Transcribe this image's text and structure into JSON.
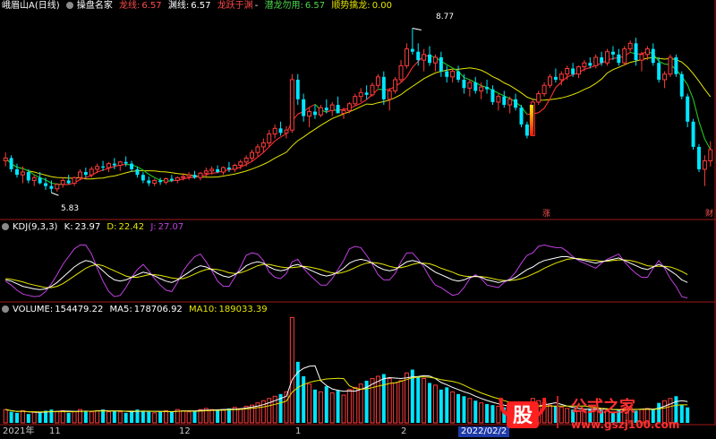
{
  "header": {
    "stock_name": "峨眉山A",
    "period": "(日线)",
    "indicator_name": "操盘名家",
    "items": [
      {
        "label": "龙线:",
        "value": "6.57",
        "color": "#ff4a4a"
      },
      {
        "label": "渊线:",
        "value": "6.57",
        "color": "#ffffff"
      },
      {
        "label": "龙跃于渊",
        "value": "",
        "color": "#ff4a4a"
      },
      {
        "label": "-",
        "value": "",
        "color": "#ffffff"
      },
      {
        "label": "潜龙勿用:",
        "value": "6.57",
        "color": "#4cd94c"
      },
      {
        "label": "顺势擒龙:",
        "value": "0.00",
        "color": "#e6e600"
      }
    ]
  },
  "kdj_header": {
    "name": "KDJ(9,3,3)",
    "k_label": "K:",
    "k_value": "23.97",
    "d_label": "D:",
    "d_value": "22.42",
    "j_label": "J:",
    "j_value": "27.07"
  },
  "volume_header": {
    "name": "VOLUME:",
    "value": "154479.22",
    "ma5_label": "MA5:",
    "ma5_value": "178706.92",
    "ma10_label": "MA10:",
    "ma10_value": "189033.39"
  },
  "markers": {
    "high_label": "8.77",
    "low_label": "5.83",
    "zhang": "涨",
    "cai": "财"
  },
  "x_axis": {
    "labels": [
      "2021年",
      "11",
      "12",
      "1",
      "2"
    ],
    "current_date": "2022/02/2"
  },
  "watermark": {
    "badge": "股",
    "title": "公式之家",
    "url": "www.gszj100.com"
  },
  "colors": {
    "up": "#ff3c3c",
    "down": "#00e6ff",
    "red_line": "#ff3030",
    "yellow_line": "#e6e600",
    "green_line": "#20c820",
    "purple_line": "#c040e0",
    "kdj_white": "#ffffff",
    "kdj_yellow": "#e6e600",
    "divider": "#a01818"
  },
  "chart_data": {
    "type": "candlestick",
    "price_range": [
      5.4,
      9.05
    ],
    "high": 8.77,
    "low": 5.83,
    "ohlc": [
      [
        6.4,
        6.55,
        6.3,
        6.45
      ],
      [
        6.45,
        6.5,
        6.2,
        6.25
      ],
      [
        6.25,
        6.35,
        6.1,
        6.15
      ],
      [
        6.15,
        6.3,
        6.0,
        6.2
      ],
      [
        6.2,
        6.25,
        6.0,
        6.05
      ],
      [
        6.05,
        6.15,
        5.95,
        6.1
      ],
      [
        6.1,
        6.2,
        5.98,
        6.0
      ],
      [
        6.0,
        6.1,
        5.88,
        5.95
      ],
      [
        5.95,
        6.05,
        5.83,
        5.9
      ],
      [
        5.9,
        6.0,
        5.85,
        5.98
      ],
      [
        5.98,
        6.1,
        5.92,
        6.05
      ],
      [
        6.05,
        6.15,
        5.98,
        6.0
      ],
      [
        6.0,
        6.12,
        5.95,
        6.1
      ],
      [
        6.1,
        6.25,
        6.05,
        6.2
      ],
      [
        6.2,
        6.28,
        6.1,
        6.15
      ],
      [
        6.15,
        6.3,
        6.1,
        6.25
      ],
      [
        6.25,
        6.35,
        6.18,
        6.3
      ],
      [
        6.3,
        6.4,
        6.22,
        6.28
      ],
      [
        6.28,
        6.38,
        6.2,
        6.35
      ],
      [
        6.35,
        6.45,
        6.25,
        6.32
      ],
      [
        6.32,
        6.4,
        6.22,
        6.38
      ],
      [
        6.38,
        6.48,
        6.3,
        6.35
      ],
      [
        6.35,
        6.4,
        6.2,
        6.25
      ],
      [
        6.25,
        6.3,
        6.1,
        6.15
      ],
      [
        6.15,
        6.2,
        6.0,
        6.05
      ],
      [
        6.05,
        6.12,
        5.95,
        6.0
      ],
      [
        6.0,
        6.08,
        5.95,
        6.05
      ],
      [
        6.05,
        6.1,
        5.97,
        6.02
      ],
      [
        6.02,
        6.1,
        5.98,
        6.08
      ],
      [
        6.08,
        6.15,
        6.02,
        6.05
      ],
      [
        6.05,
        6.12,
        6.0,
        6.1
      ],
      [
        6.1,
        6.18,
        6.05,
        6.12
      ],
      [
        6.12,
        6.2,
        6.06,
        6.15
      ],
      [
        6.15,
        6.22,
        6.08,
        6.1
      ],
      [
        6.1,
        6.2,
        6.05,
        6.18
      ],
      [
        6.18,
        6.28,
        6.12,
        6.22
      ],
      [
        6.22,
        6.3,
        6.15,
        6.25
      ],
      [
        6.25,
        6.32,
        6.18,
        6.2
      ],
      [
        6.2,
        6.3,
        6.15,
        6.28
      ],
      [
        6.28,
        6.38,
        6.2,
        6.25
      ],
      [
        6.25,
        6.35,
        6.2,
        6.32
      ],
      [
        6.32,
        6.42,
        6.25,
        6.38
      ],
      [
        6.38,
        6.5,
        6.3,
        6.45
      ],
      [
        6.45,
        6.6,
        6.4,
        6.55
      ],
      [
        6.55,
        6.7,
        6.48,
        6.65
      ],
      [
        6.65,
        6.8,
        6.55,
        6.72
      ],
      [
        6.72,
        6.95,
        6.65,
        6.88
      ],
      [
        6.88,
        7.05,
        6.8,
        6.98
      ],
      [
        6.98,
        7.1,
        6.85,
        6.9
      ],
      [
        6.9,
        7.02,
        6.8,
        6.95
      ],
      [
        6.95,
        7.95,
        6.9,
        7.85
      ],
      [
        7.85,
        7.95,
        7.4,
        7.5
      ],
      [
        7.5,
        7.6,
        7.1,
        7.2
      ],
      [
        7.2,
        7.35,
        7.0,
        7.28
      ],
      [
        7.28,
        7.4,
        7.15,
        7.22
      ],
      [
        7.22,
        7.4,
        7.18,
        7.35
      ],
      [
        7.35,
        7.5,
        7.25,
        7.3
      ],
      [
        7.3,
        7.45,
        7.2,
        7.4
      ],
      [
        7.4,
        7.55,
        7.3,
        7.25
      ],
      [
        7.25,
        7.35,
        7.15,
        7.3
      ],
      [
        7.3,
        7.45,
        7.25,
        7.42
      ],
      [
        7.42,
        7.6,
        7.38,
        7.55
      ],
      [
        7.55,
        7.7,
        7.45,
        7.62
      ],
      [
        7.62,
        7.75,
        7.5,
        7.58
      ],
      [
        7.58,
        7.8,
        7.55,
        7.75
      ],
      [
        7.75,
        7.95,
        7.7,
        7.9
      ],
      [
        7.9,
        8.0,
        7.4,
        7.5
      ],
      [
        7.5,
        7.7,
        7.3,
        7.65
      ],
      [
        7.65,
        7.9,
        7.6,
        7.85
      ],
      [
        7.85,
        8.2,
        7.8,
        8.1
      ],
      [
        8.1,
        8.5,
        8.05,
        8.4
      ],
      [
        8.4,
        8.77,
        8.3,
        8.35
      ],
      [
        8.35,
        8.5,
        8.1,
        8.2
      ],
      [
        8.2,
        8.4,
        8.0,
        8.3
      ],
      [
        8.3,
        8.45,
        8.1,
        8.15
      ],
      [
        8.15,
        8.3,
        8.0,
        8.25
      ],
      [
        8.25,
        8.35,
        7.9,
        8.0
      ],
      [
        8.0,
        8.1,
        7.8,
        7.9
      ],
      [
        7.9,
        8.05,
        7.8,
        8.0
      ],
      [
        8.0,
        8.1,
        7.8,
        7.85
      ],
      [
        7.85,
        7.95,
        7.6,
        7.7
      ],
      [
        7.7,
        7.85,
        7.55,
        7.8
      ],
      [
        7.8,
        7.9,
        7.6,
        7.65
      ],
      [
        7.65,
        7.8,
        7.5,
        7.72
      ],
      [
        7.72,
        7.85,
        7.6,
        7.68
      ],
      [
        7.68,
        7.75,
        7.4,
        7.45
      ],
      [
        7.45,
        7.6,
        7.3,
        7.55
      ],
      [
        7.55,
        7.65,
        7.35,
        7.4
      ],
      [
        7.4,
        7.55,
        7.25,
        7.5
      ],
      [
        7.5,
        7.6,
        7.3,
        7.35
      ],
      [
        7.35,
        7.4,
        7.0,
        7.05
      ],
      [
        7.05,
        7.1,
        6.8,
        6.85
      ],
      [
        6.85,
        7.5,
        6.85,
        7.45
      ],
      [
        7.45,
        7.65,
        7.4,
        7.6
      ],
      [
        7.6,
        7.8,
        7.55,
        7.75
      ],
      [
        7.75,
        7.95,
        7.7,
        7.9
      ],
      [
        7.9,
        8.05,
        7.8,
        7.85
      ],
      [
        7.85,
        8.0,
        7.75,
        7.95
      ],
      [
        7.95,
        8.1,
        7.85,
        8.05
      ],
      [
        8.05,
        8.15,
        7.9,
        7.95
      ],
      [
        7.95,
        8.1,
        7.88,
        8.08
      ],
      [
        8.08,
        8.2,
        8.0,
        8.15
      ],
      [
        8.15,
        8.25,
        8.05,
        8.1
      ],
      [
        8.1,
        8.3,
        8.05,
        8.25
      ],
      [
        8.25,
        8.35,
        8.1,
        8.15
      ],
      [
        8.15,
        8.4,
        8.1,
        8.35
      ],
      [
        8.35,
        8.45,
        8.2,
        8.3
      ],
      [
        8.3,
        8.4,
        8.1,
        8.15
      ],
      [
        8.15,
        8.45,
        8.1,
        8.4
      ],
      [
        8.4,
        8.55,
        8.35,
        8.5
      ],
      [
        8.5,
        8.6,
        8.1,
        8.2
      ],
      [
        8.2,
        8.35,
        8.0,
        8.3
      ],
      [
        8.3,
        8.45,
        8.2,
        8.4
      ],
      [
        8.4,
        8.5,
        8.1,
        8.15
      ],
      [
        8.15,
        8.25,
        7.8,
        7.85
      ],
      [
        7.85,
        8.0,
        7.7,
        7.95
      ],
      [
        7.95,
        8.3,
        7.9,
        8.25
      ],
      [
        8.25,
        8.3,
        7.9,
        7.95
      ],
      [
        7.95,
        8.0,
        7.5,
        7.55
      ],
      [
        7.55,
        7.6,
        7.0,
        7.1
      ],
      [
        7.1,
        7.15,
        6.6,
        6.65
      ],
      [
        6.65,
        6.7,
        6.2,
        6.25
      ],
      [
        6.25,
        6.5,
        5.95,
        6.4
      ],
      [
        6.4,
        6.75,
        6.3,
        6.6
      ]
    ],
    "volume": [
      12,
      10,
      9,
      11,
      8,
      10,
      9,
      11,
      12,
      10,
      11,
      9,
      10,
      12,
      11,
      10,
      11,
      12,
      10,
      11,
      10,
      9,
      10,
      12,
      11,
      10,
      9,
      10,
      11,
      10,
      12,
      11,
      10,
      11,
      12,
      13,
      12,
      11,
      12,
      13,
      14,
      13,
      15,
      16,
      18,
      20,
      22,
      24,
      26,
      28,
      95,
      55,
      42,
      35,
      30,
      28,
      33,
      27,
      29,
      25,
      30,
      32,
      35,
      38,
      40,
      42,
      44,
      40,
      36,
      38,
      45,
      48,
      42,
      40,
      36,
      34,
      30,
      32,
      28,
      26,
      24,
      22,
      20,
      18,
      17,
      16,
      15,
      14,
      13,
      12,
      11,
      10,
      22,
      20,
      18,
      16,
      15,
      14,
      13,
      12,
      11,
      12,
      13,
      14,
      12,
      11,
      10,
      12,
      13,
      14,
      11,
      12,
      13,
      12,
      18,
      20,
      22,
      24,
      16,
      14
    ],
    "kdj": {
      "k": [
        30,
        28,
        24,
        20,
        18,
        16,
        15,
        16,
        20,
        26,
        34,
        42,
        50,
        56,
        60,
        58,
        52,
        44,
        36,
        30,
        28,
        30,
        34,
        38,
        42,
        40,
        36,
        32,
        28,
        26,
        30,
        36,
        42,
        48,
        52,
        50,
        46,
        40,
        36,
        34,
        38,
        44,
        52,
        56,
        58,
        56,
        50,
        46,
        44,
        46,
        52,
        54,
        50,
        46,
        42,
        38,
        36,
        38,
        42,
        48,
        56,
        60,
        62,
        60,
        56,
        50,
        46,
        44,
        46,
        52,
        58,
        60,
        58,
        54,
        48,
        42,
        38,
        34,
        30,
        28,
        30,
        34,
        36,
        34,
        30,
        28,
        26,
        28,
        30,
        34,
        40,
        46,
        50,
        56,
        60,
        62,
        64,
        66,
        66,
        64,
        62,
        60,
        58,
        56,
        58,
        60,
        62,
        64,
        60,
        56,
        52,
        48,
        46,
        50,
        54,
        50,
        44,
        38,
        30,
        26
      ],
      "d": [
        32,
        31,
        29,
        27,
        24,
        22,
        20,
        18,
        18,
        20,
        24,
        30,
        36,
        42,
        48,
        52,
        54,
        52,
        48,
        44,
        40,
        36,
        34,
        34,
        36,
        38,
        38,
        37,
        35,
        33,
        32,
        32,
        35,
        39,
        43,
        46,
        47,
        46,
        44,
        41,
        40,
        41,
        44,
        48,
        52,
        54,
        54,
        52,
        50,
        49,
        49,
        50,
        51,
        50,
        48,
        46,
        43,
        41,
        40,
        42,
        45,
        49,
        53,
        56,
        57,
        56,
        54,
        51,
        49,
        49,
        51,
        54,
        56,
        56,
        55,
        52,
        48,
        45,
        42,
        38,
        36,
        35,
        35,
        35,
        34,
        32,
        30,
        29,
        29,
        30,
        32,
        35,
        39,
        43,
        48,
        52,
        56,
        59,
        62,
        63,
        63,
        62,
        61,
        60,
        59,
        59,
        60,
        61,
        61,
        60,
        58,
        55,
        52,
        51,
        51,
        51,
        50,
        47,
        43,
        38
      ],
      "j": [
        28,
        22,
        14,
        8,
        6,
        4,
        5,
        12,
        24,
        38,
        54,
        66,
        78,
        84,
        84,
        70,
        48,
        28,
        12,
        4,
        6,
        18,
        34,
        46,
        54,
        44,
        32,
        22,
        14,
        12,
        26,
        44,
        56,
        66,
        70,
        58,
        44,
        28,
        20,
        20,
        34,
        50,
        68,
        72,
        70,
        60,
        42,
        34,
        32,
        40,
        58,
        62,
        48,
        38,
        30,
        22,
        22,
        32,
        46,
        60,
        78,
        82,
        80,
        68,
        54,
        38,
        30,
        30,
        40,
        58,
        72,
        72,
        62,
        50,
        34,
        22,
        18,
        12,
        6,
        8,
        18,
        32,
        38,
        32,
        22,
        20,
        18,
        26,
        32,
        42,
        56,
        68,
        72,
        82,
        84,
        82,
        80,
        80,
        74,
        66,
        60,
        56,
        52,
        48,
        56,
        62,
        66,
        70,
        58,
        48,
        40,
        34,
        34,
        48,
        60,
        48,
        32,
        20,
        4,
        2
      ]
    }
  }
}
